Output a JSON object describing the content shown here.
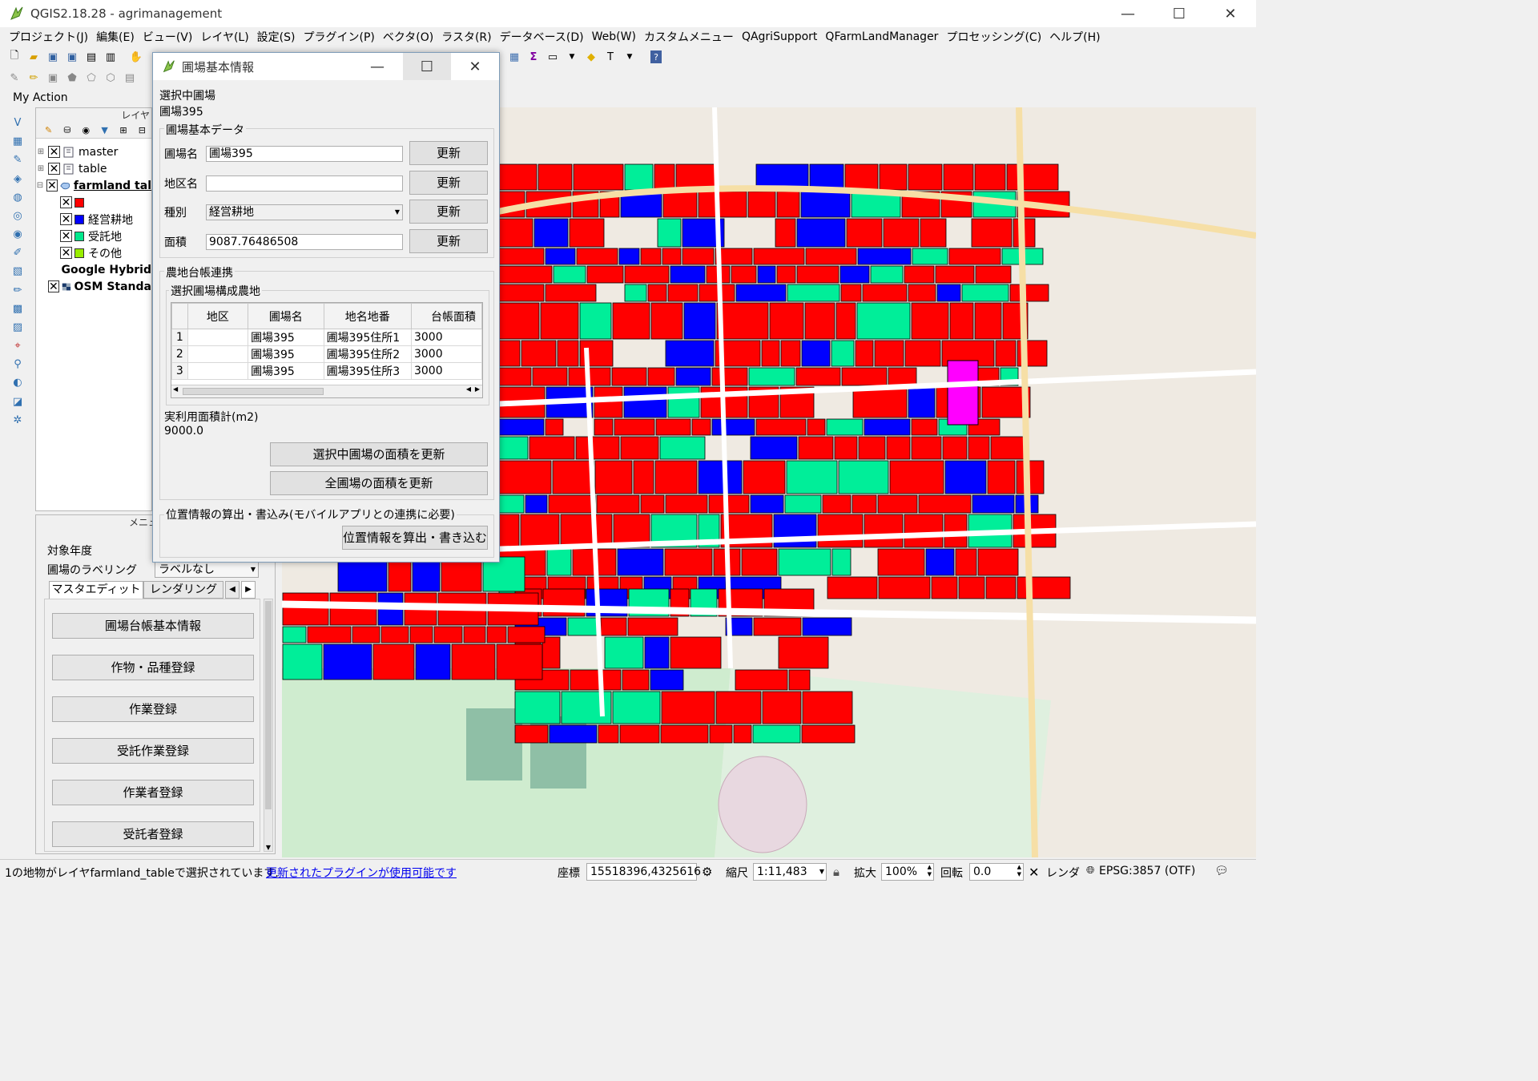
{
  "window": {
    "title": "QGIS2.18.28 - agrimanagement",
    "minimize_glyph": "—",
    "maximize_glyph": "☐",
    "close_glyph": "✕"
  },
  "menubar": [
    "プロジェクト(J)",
    "編集(E)",
    "ビュー(V)",
    "レイヤ(L)",
    "設定(S)",
    "プラグイン(P)",
    "ベクタ(O)",
    "ラスタ(R)",
    "データベース(D)",
    "Web(W)",
    "カスタムメニュー",
    "QAgriSupport",
    "QFarmLandManager",
    "プロセッシング(C)",
    "ヘルプ(H)"
  ],
  "toolbar": {
    "my_action": "My Action"
  },
  "layers_panel": {
    "header": "レイヤ",
    "layers": [
      {
        "name": "master",
        "checked": true
      },
      {
        "name": "table",
        "checked": true
      },
      {
        "name": "farmland tal",
        "checked": true
      },
      {
        "name": "",
        "checked": true,
        "color": "#ff0000"
      },
      {
        "name": "経営耕地",
        "checked": true,
        "color": "#0000ff"
      },
      {
        "name": "受託地",
        "checked": true,
        "color": "#00e88c"
      },
      {
        "name": "その他",
        "checked": true,
        "color": "#99ee00"
      },
      {
        "name": "Google Hybrid",
        "checked": false
      },
      {
        "name": "OSM Standa",
        "checked": true
      }
    ]
  },
  "menu_dock": {
    "header": "メニュ",
    "target_year_label": "対象年度",
    "labeling_label": "圃場のラベリング",
    "labeling_value": "ラベルなし",
    "tabs": [
      "マスタエディット",
      "レンダリング"
    ],
    "buttons": [
      "圃場台帳基本情報",
      "作物・品種登録",
      "作業登録",
      "受託作業登録",
      "作業者登録",
      "受託者登録"
    ]
  },
  "dialog": {
    "title": "圃場基本情報",
    "selected_label": "選択中圃場",
    "selected_value": "圃場395",
    "basic_group": "圃場基本データ",
    "fields": [
      {
        "label": "圃場名",
        "value": "圃場395",
        "button": "更新"
      },
      {
        "label": "地区名",
        "value": "",
        "button": "更新"
      },
      {
        "label": "種別",
        "value": "経営耕地",
        "button": "更新"
      },
      {
        "label": "面積",
        "value": "9087.76486508",
        "button": "更新"
      }
    ],
    "ledger_group": "農地台帳連携",
    "ledger_subgroup": "選択圃場構成農地",
    "ledger_columns": [
      "地区",
      "圃場名",
      "地名地番",
      "台帳面積"
    ],
    "ledger_rows": [
      {
        "n": "1",
        "district": "",
        "field": "圃場395",
        "address": "圃場395住所1",
        "area": "3000"
      },
      {
        "n": "2",
        "district": "",
        "field": "圃場395",
        "address": "圃場395住所2",
        "area": "3000"
      },
      {
        "n": "3",
        "district": "",
        "field": "圃場395",
        "address": "圃場395住所3",
        "area": "3000"
      }
    ],
    "total_label": "実利用面積計(m2)",
    "total_value": "9000.0",
    "update_selected_button": "選択中圃場の面積を更新",
    "update_all_button": "全圃場の面積を更新",
    "position_label": "位置情報の算出・書込み(モバイルアプリとの連携に必要)",
    "position_button": "位置情報を算出・書き込む"
  },
  "statusbar": {
    "message": "1の地物がレイヤfarmland_tableで選択されています.",
    "plugin_link": "更新されたプラグインが使用可能です",
    "coord_label": "座標",
    "coord_value": "15518396,4325616",
    "scale_label": "縮尺",
    "scale_value": "1:11,483",
    "zoom_label": "拡大",
    "zoom_value": "100%",
    "rotation_label": "回転",
    "rotation_value": "0.0",
    "render_label": "レンダ",
    "crs": "EPSG:3857 (OTF)"
  },
  "map_colors": {
    "managed": "#ff0000",
    "own": "#0000ff",
    "consigned": "#00ee99",
    "selected": "#ff00ff",
    "park": "#cfeccf",
    "road": "#ffffff",
    "road_major": "#f6dfa6"
  }
}
